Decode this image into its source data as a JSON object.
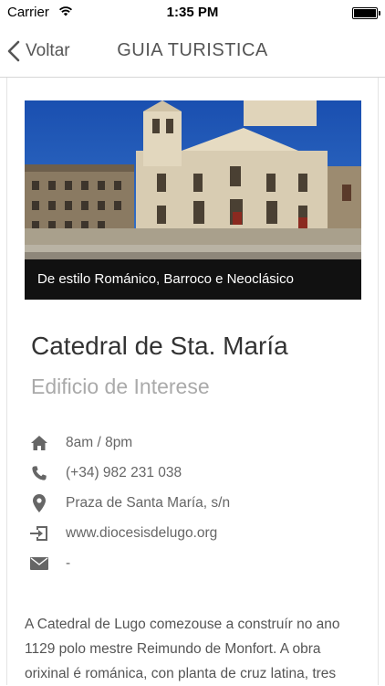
{
  "status_bar": {
    "carrier": "Carrier",
    "time": "1:35 PM"
  },
  "nav": {
    "back_label": "Voltar",
    "title": "GUIA TURISTICA"
  },
  "place": {
    "photo_caption": "De estilo Románico, Barroco e Neoclásico",
    "title": "Catedral de Sta. María",
    "category": "Edificio de Interese",
    "hours": "8am / 8pm",
    "phone": "(+34) 982 231 038",
    "address": "Praza de Santa María, s/n",
    "website": "www.diocesisdelugo.org",
    "email": "-",
    "description": "A Catedral de Lugo comezouse a construír no ano 1129 polo mestre Reimundo de Monfort. A obra orixinal é románica, con planta de cruz latina, tres"
  },
  "icons": {
    "hours": "home-icon",
    "phone": "phone-icon",
    "address": "map-pin-icon",
    "website": "external-link-icon",
    "email": "mail-icon"
  },
  "colors": {
    "caption_bg": "#111111",
    "icon": "#666666",
    "category": "#aaaaaa"
  }
}
